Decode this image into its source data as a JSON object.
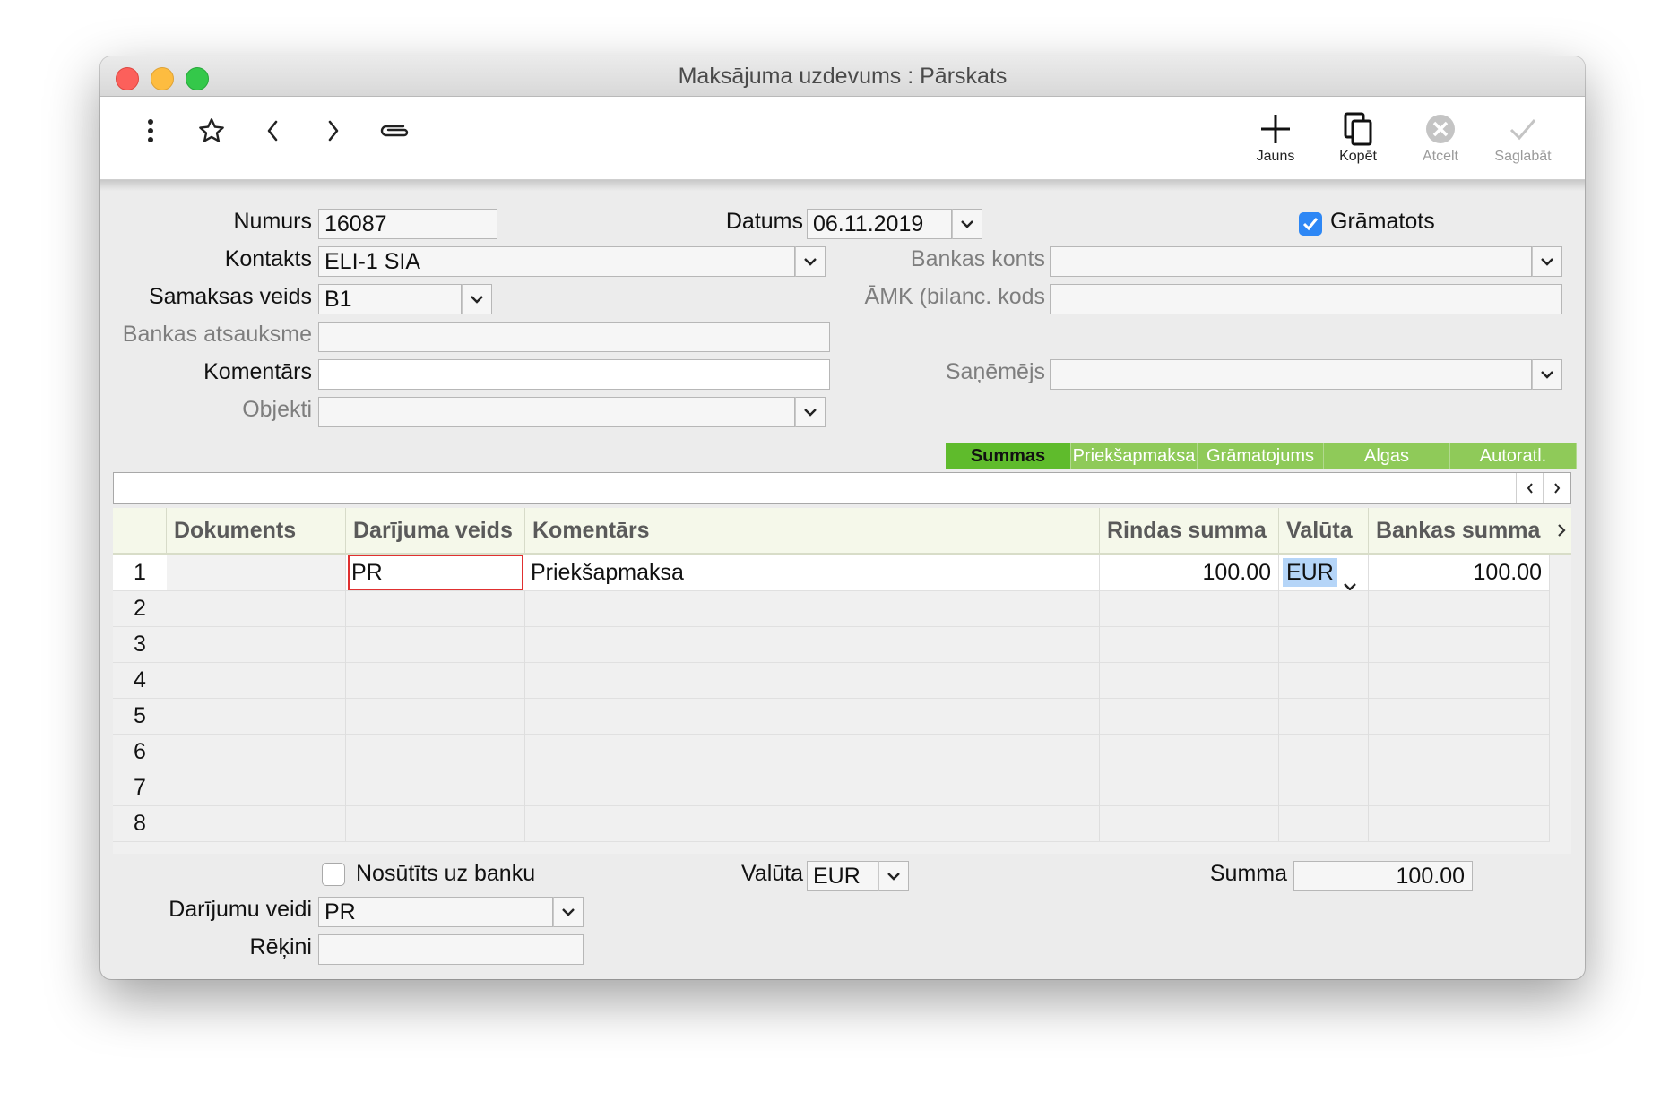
{
  "window": {
    "title": "Maksājuma uzdevums : Pārskats"
  },
  "toolbar": {
    "new_label": "Jauns",
    "copy_label": "Kopēt",
    "cancel_label": "Atcelt",
    "save_label": "Saglabāt"
  },
  "form": {
    "numurs_label": "Numurs",
    "numurs_value": "16087",
    "kontakts_label": "Kontakts",
    "kontakts_value": "ELI-1 SIA",
    "samaksas_label": "Samaksas veids",
    "samaksas_value": "B1",
    "atsauksme_label": "Bankas atsauksme",
    "atsauksme_value": "",
    "komentars_label": "Komentārs",
    "komentars_value": "",
    "objekti_label": "Objekti",
    "objekti_value": "",
    "datums_label": "Datums",
    "datums_value": "06.11.2019",
    "gramatots_label": "Grāmatots",
    "gramatots_checked": true,
    "bankas_konts_label": "Bankas konts",
    "bankas_konts_value": "",
    "amk_label": "ĀMK (bilanc. kods",
    "amk_value": "",
    "sanemejs_label": "Saņēmējs",
    "sanemejs_value": ""
  },
  "tabs": [
    "Summas",
    "Priekšapmaksa",
    "Grāmatojums",
    "Algas",
    "Autoratl."
  ],
  "active_tab": "Summas",
  "grid": {
    "columns": [
      "Dokuments",
      "Darījuma veids",
      "Komentārs",
      "Rindas summa",
      "Valūta",
      "Bankas summa"
    ],
    "rows": [
      {
        "n": "1",
        "dokuments": "",
        "veids": "PR",
        "komentars": "Priekšapmaksa",
        "rindas_summa": "100.00",
        "valuta": "EUR",
        "bankas_summa": "100.00"
      },
      {
        "n": "2",
        "dokuments": "",
        "veids": "",
        "komentars": "",
        "rindas_summa": "",
        "valuta": "",
        "bankas_summa": ""
      },
      {
        "n": "3",
        "dokuments": "",
        "veids": "",
        "komentars": "",
        "rindas_summa": "",
        "valuta": "",
        "bankas_summa": ""
      },
      {
        "n": "4",
        "dokuments": "",
        "veids": "",
        "komentars": "",
        "rindas_summa": "",
        "valuta": "",
        "bankas_summa": ""
      },
      {
        "n": "5",
        "dokuments": "",
        "veids": "",
        "komentars": "",
        "rindas_summa": "",
        "valuta": "",
        "bankas_summa": ""
      },
      {
        "n": "6",
        "dokuments": "",
        "veids": "",
        "komentars": "",
        "rindas_summa": "",
        "valuta": "",
        "bankas_summa": ""
      },
      {
        "n": "7",
        "dokuments": "",
        "veids": "",
        "komentars": "",
        "rindas_summa": "",
        "valuta": "",
        "bankas_summa": ""
      },
      {
        "n": "8",
        "dokuments": "",
        "veids": "",
        "komentars": "",
        "rindas_summa": "",
        "valuta": "",
        "bankas_summa": ""
      }
    ]
  },
  "bottom": {
    "nosutits_label": "Nosūtīts uz banku",
    "nosutits_checked": false,
    "valuta_label": "Valūta",
    "valuta_value": "EUR",
    "summa_label": "Summa",
    "summa_value": "100.00",
    "darijumu_label": "Darījumu veidi",
    "darijumu_value": "PR",
    "rekini_label": "Rēķini",
    "rekini_value": ""
  },
  "colors": {
    "tab_active": "#5fbb2c",
    "tab_inactive": "#8fca59",
    "checkbox_on": "#2d87f5",
    "selected_cell_border": "#e03030",
    "grid_header_bg": "#f5f8ea"
  }
}
